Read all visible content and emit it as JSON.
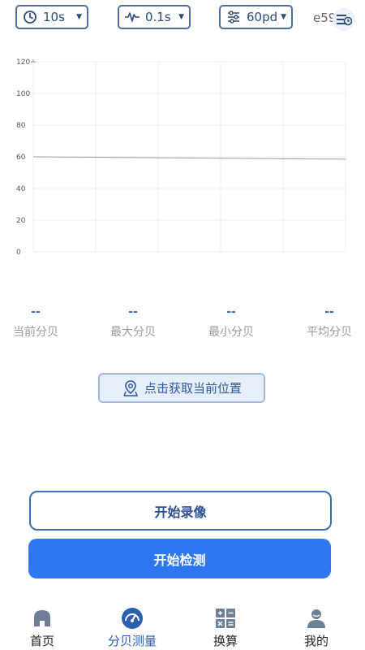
{
  "controls": {
    "duration": {
      "value": "10s",
      "icon": "clock-icon"
    },
    "interval": {
      "value": "0.1s",
      "icon": "waveform-icon"
    },
    "calibration": {
      "value": "60pd",
      "icon": "sliders-icon"
    }
  },
  "device": {
    "id": "e59",
    "icon": "equalizer-badge-icon"
  },
  "chart_data": {
    "type": "line",
    "title": "",
    "xlabel": "",
    "ylabel": "",
    "y_ticks": [
      "0",
      "20",
      "40",
      "60",
      "80",
      "100",
      "120+"
    ],
    "ylim": [
      0,
      120
    ],
    "grid": true,
    "series": [
      {
        "values": [
          60,
          58.5
        ]
      }
    ],
    "colors": {
      "line": "#9a9a9a",
      "grid": "#eeeeee"
    }
  },
  "stats": [
    {
      "value": "--",
      "label": "当前分贝"
    },
    {
      "value": "--",
      "label": "最大分贝"
    },
    {
      "value": "--",
      "label": "最小分贝"
    },
    {
      "value": "--",
      "label": "平均分贝"
    }
  ],
  "location_button": {
    "label": "点击获取当前位置",
    "icon": "map-pin-icon"
  },
  "record_button": {
    "label": "开始录像"
  },
  "detect_button": {
    "label": "开始检测"
  },
  "nav": [
    {
      "label": "首页",
      "icon": "home-icon",
      "active": false
    },
    {
      "label": "分贝测量",
      "icon": "gauge-icon",
      "active": true
    },
    {
      "label": "换算",
      "icon": "calculator-icon",
      "active": false
    },
    {
      "label": "我的",
      "icon": "user-icon",
      "active": false
    }
  ],
  "colors": {
    "accent": "#2d78f0",
    "stat_value": "#3b6bc4",
    "control_border": "#4a6fa5"
  }
}
